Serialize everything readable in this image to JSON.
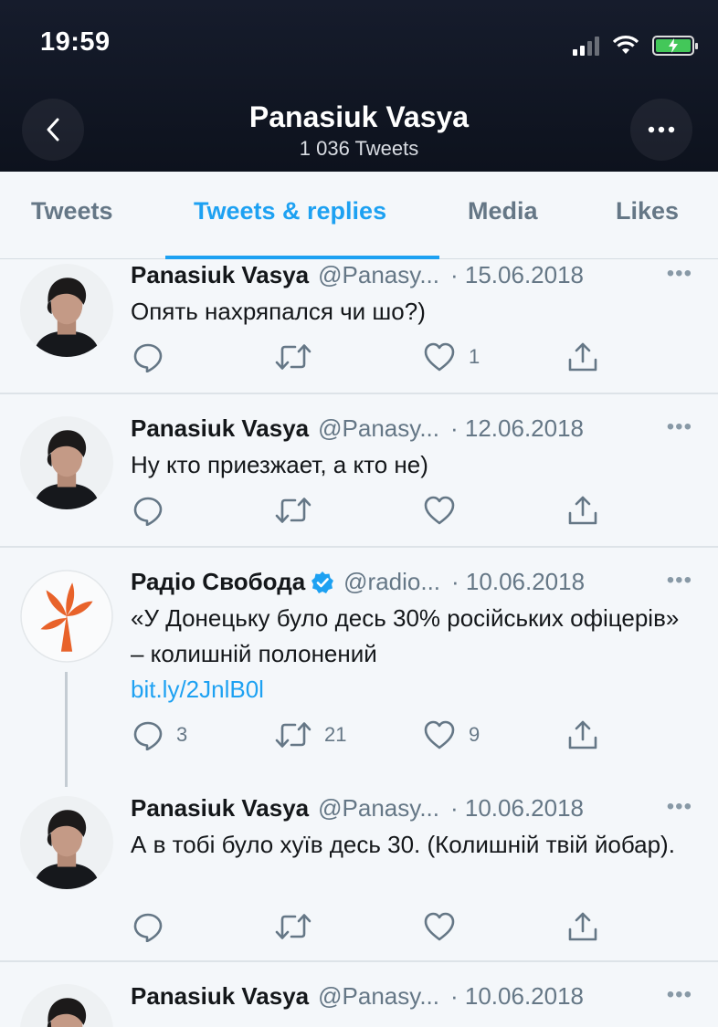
{
  "status_bar": {
    "time": "19:59"
  },
  "header": {
    "title": "Panasiuk Vasya",
    "tweet_count": "1 036 Tweets"
  },
  "tabs": [
    {
      "label": "Tweets",
      "active": false
    },
    {
      "label": "Tweets & replies",
      "active": true
    },
    {
      "label": "Media",
      "active": false
    },
    {
      "label": "Likes",
      "active": false
    }
  ],
  "tweets": [
    {
      "name": "Panasiuk Vasya",
      "handle": "@Panasy...",
      "date": "· 15.06.2018",
      "text": "Опять нахряпался чи шо?)",
      "replies": "",
      "retweets": "",
      "likes": "1"
    },
    {
      "name": "Panasiuk Vasya",
      "handle": "@Panasy...",
      "date": "· 12.06.2018",
      "text": "Ну кто приезжает, а кто не)",
      "replies": "",
      "retweets": "",
      "likes": ""
    },
    {
      "name": "Радіо Свобода",
      "handle": "@radio...",
      "date": "· 10.06.2018",
      "verified": true,
      "text": "«У Донецьку було десь 30% російських офіцерів» – колишній полонений",
      "link": "bit.ly/2JnlB0l",
      "replies": "3",
      "retweets": "21",
      "likes": "9"
    },
    {
      "name": "Panasiuk Vasya",
      "handle": "@Panasy...",
      "date": "· 10.06.2018",
      "text": "А в тобі було хуїв десь 30. (Колишній твій йобар).",
      "replies": "",
      "retweets": "",
      "likes": ""
    },
    {
      "name": "Panasiuk Vasya",
      "handle": "@Panasy...",
      "date": "· 10.06.2018"
    }
  ],
  "icons": {
    "back": "chevron-left-icon",
    "more": "more-horizontal-icon",
    "reply": "reply-icon",
    "retweet": "retweet-icon",
    "like": "heart-icon",
    "share": "share-icon",
    "verified": "verified-badge-icon"
  },
  "colors": {
    "accent": "#1da1f2",
    "header_bg": "#111827",
    "muted": "#657786",
    "brand_radio": "#e8622a"
  }
}
